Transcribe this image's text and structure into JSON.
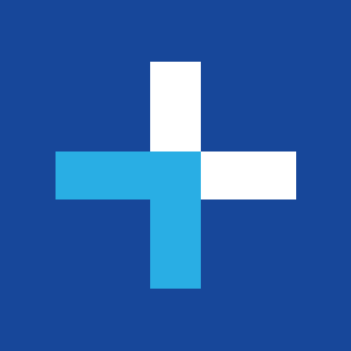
{
  "icon": {
    "name": "plus-cross-logo-icon",
    "background_color": "#17479a",
    "colors": {
      "primary_white": "#ffffff",
      "accent_light_blue": "#29aee4"
    }
  }
}
